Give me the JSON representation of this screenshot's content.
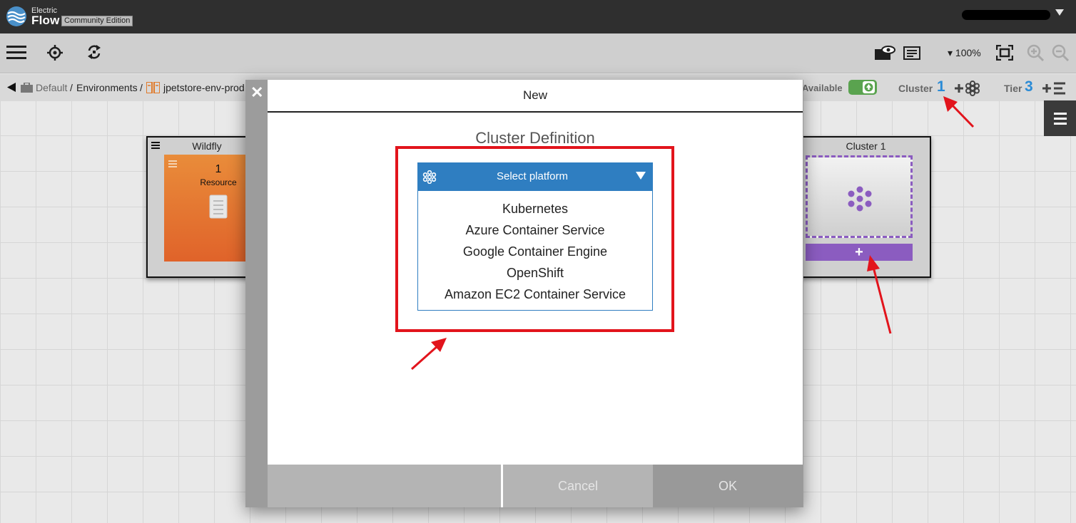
{
  "app": {
    "logo_small": "Electric",
    "logo_big": "Flow",
    "edition": "Community Edition"
  },
  "toolbar": {
    "zoom": "▾ 100%"
  },
  "breadcrumb": {
    "default": "Default",
    "sep1": "/",
    "environments": "Environments",
    "sep2": "/",
    "environment": "jpetstore-env-prod"
  },
  "status": {
    "available_label": "Available",
    "cluster_label": "Cluster",
    "cluster_count": "1",
    "tier_label": "Tier",
    "tier_count": "3"
  },
  "tiers": {
    "wildfly": {
      "title": "Wildfly",
      "resource_count": "1",
      "resource_label": "Resource"
    },
    "cluster": {
      "title": "Cluster 1",
      "add_label": "+"
    }
  },
  "modal": {
    "close": "✕",
    "title": "New",
    "subtitle": "Cluster Definition",
    "select_placeholder": "Select platform",
    "options": [
      "Kubernetes",
      "Azure Container Service",
      "Google Container Engine",
      "OpenShift",
      "Amazon EC2 Container Service"
    ],
    "cancel": "Cancel",
    "ok": "OK"
  },
  "colors": {
    "accent_blue": "#2f7ec1",
    "highlight_red": "#e2141c",
    "cluster_purple": "#8b5cc0",
    "toggle_green": "#5aa34f"
  }
}
